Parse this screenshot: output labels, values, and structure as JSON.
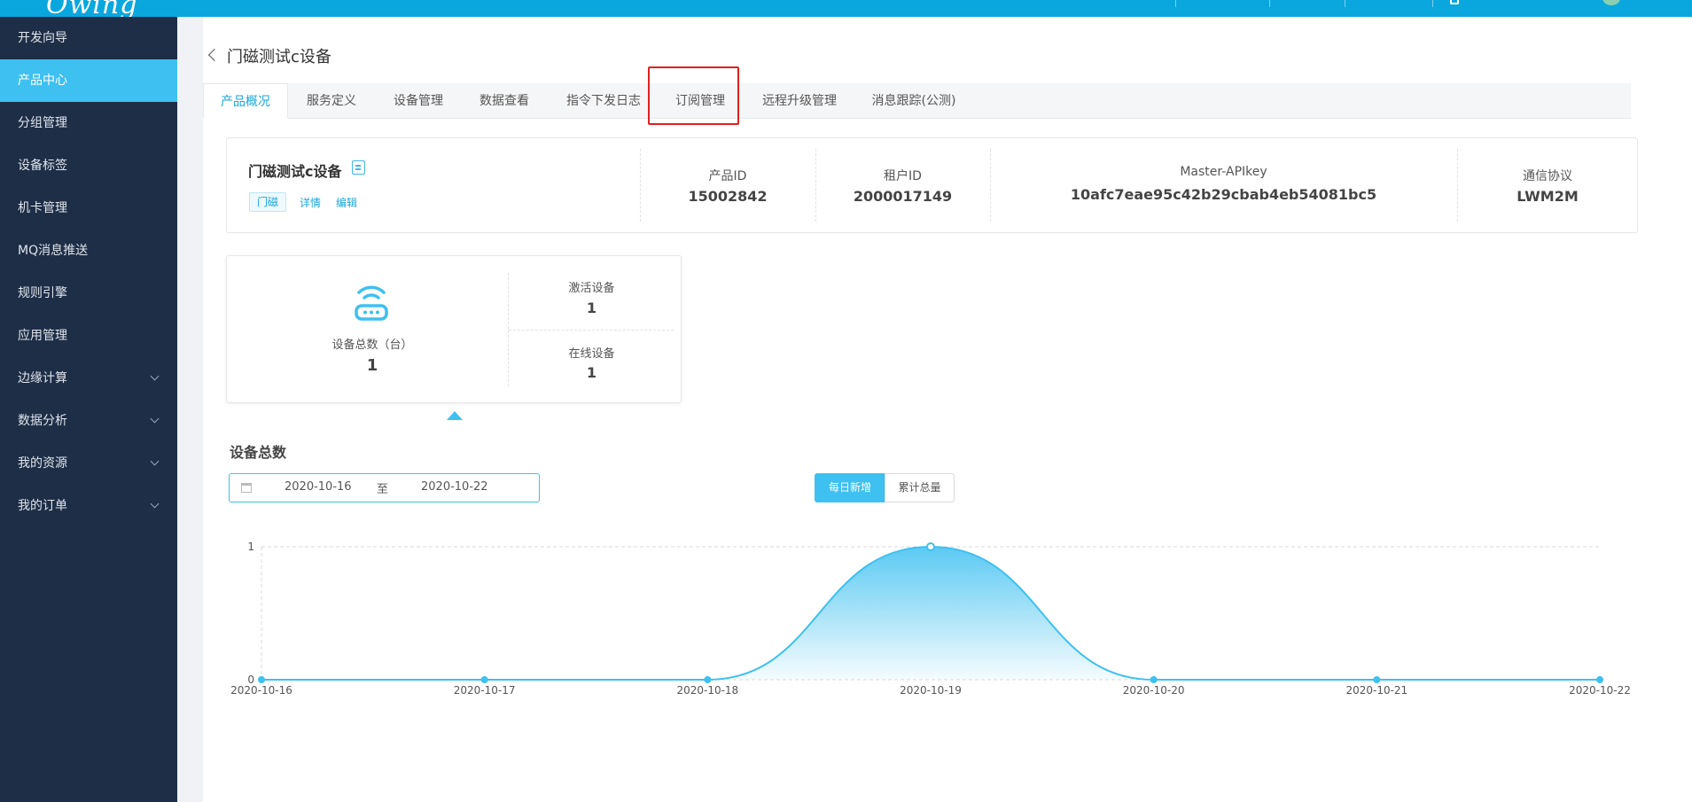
{
  "brand": {
    "logo": "Owing",
    "logo_sub": ""
  },
  "topbar": {
    "user": ""
  },
  "sidebar": {
    "items": [
      {
        "label": "开发向导",
        "active": false,
        "expandable": false
      },
      {
        "label": "产品中心",
        "active": true,
        "expandable": false
      },
      {
        "label": "分组管理",
        "active": false,
        "expandable": false
      },
      {
        "label": "设备标签",
        "active": false,
        "expandable": false
      },
      {
        "label": "机卡管理",
        "active": false,
        "expandable": false
      },
      {
        "label": "MQ消息推送",
        "active": false,
        "expandable": false
      },
      {
        "label": "规则引擎",
        "active": false,
        "expandable": false
      },
      {
        "label": "应用管理",
        "active": false,
        "expandable": false
      },
      {
        "label": "边缘计算",
        "active": false,
        "expandable": true
      },
      {
        "label": "数据分析",
        "active": false,
        "expandable": true
      },
      {
        "label": "我的资源",
        "active": false,
        "expandable": true
      },
      {
        "label": "我的订单",
        "active": false,
        "expandable": true
      }
    ]
  },
  "page": {
    "title": "门磁测试c设备"
  },
  "tabs": [
    {
      "label": "产品概况",
      "active": true
    },
    {
      "label": "服务定义",
      "active": false
    },
    {
      "label": "设备管理",
      "active": false
    },
    {
      "label": "数据查看",
      "active": false
    },
    {
      "label": "指令下发日志",
      "active": false
    },
    {
      "label": "订阅管理",
      "active": false,
      "highlighted": true
    },
    {
      "label": "远程升级管理",
      "active": false
    },
    {
      "label": "消息跟踪(公测)",
      "active": false
    }
  ],
  "product": {
    "name": "门磁测试c设备",
    "tag": "门磁",
    "detail_link": "详情",
    "edit_link": "编辑",
    "product_id_label": "产品ID",
    "product_id": "15002842",
    "tenant_id_label": "租户ID",
    "tenant_id": "2000017149",
    "apikey_label": "Master-APIkey",
    "apikey": "10afc7eae95c42b29cbab4eb54081bc5",
    "protocol_label": "通信协议",
    "protocol": "LWM2M"
  },
  "devices": {
    "total_label": "设备总数（台）",
    "total": "1",
    "activated_label": "激活设备",
    "activated": "1",
    "online_label": "在线设备",
    "online": "1"
  },
  "chart_section": {
    "title": "设备总数",
    "date_start": "2020-10-16",
    "date_sep": "至",
    "date_end": "2020-10-22",
    "mode_daily": "每日新增",
    "mode_cumulative": "累计总量"
  },
  "colors": {
    "accent": "#3ec0f0",
    "topbar": "#0aa7de",
    "sidebar": "#1f2e47",
    "highlight_box": "#e02020"
  },
  "chart_data": {
    "type": "area",
    "x": [
      "2020-10-16",
      "2020-10-17",
      "2020-10-18",
      "2020-10-19",
      "2020-10-20",
      "2020-10-21",
      "2020-10-22"
    ],
    "series": [
      {
        "values": [
          0,
          0,
          0,
          1,
          0,
          0,
          0
        ]
      }
    ],
    "ylim": [
      0,
      1
    ],
    "yticks": [
      "0",
      "1"
    ],
    "grid": true,
    "smooth": true
  }
}
